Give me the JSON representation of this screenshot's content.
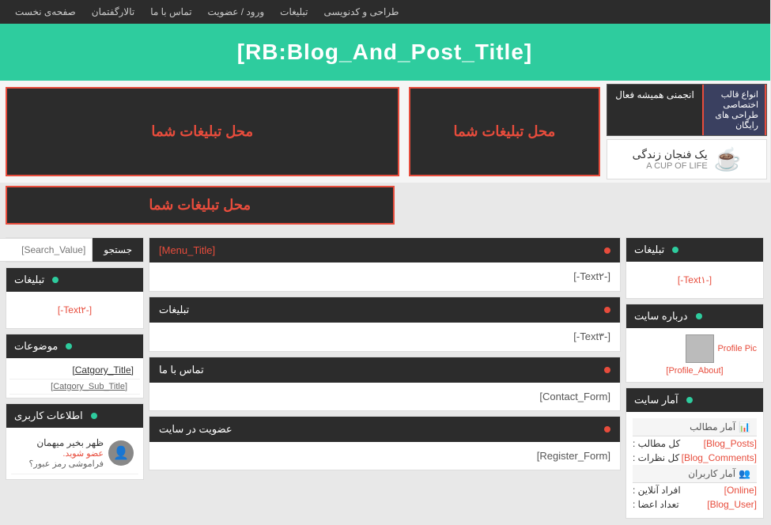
{
  "nav": {
    "items": [
      {
        "label": "صفحه‌ی نخست",
        "id": "home"
      },
      {
        "label": "تالارگفتمان",
        "id": "forum"
      },
      {
        "label": "تماس با ما",
        "id": "contact"
      },
      {
        "label": "ورود / عضویت",
        "id": "login"
      },
      {
        "label": "تبلیغات",
        "id": "ads"
      },
      {
        "label": "طراحی و کدنویسی",
        "id": "design"
      }
    ]
  },
  "header": {
    "title": "[RB:Blog_And_Post_Title]"
  },
  "ads": {
    "top_left_1": "محل تبلیغات شما",
    "top_right_1": "محل تبلیغات شما",
    "top_left_2": "محل تبلیغات شما",
    "cup_line1": "یک فنجان زندگی",
    "cup_line2": "A CUP OF LIFE",
    "forum_text": "انجمنی همیشه فعال",
    "forum_sub": "طراحی های رایگان",
    "forum_type": "انواع قالب اختصاصی"
  },
  "left_sidebar": {
    "ads_header": "تبلیغات",
    "ads_text": "[-Text۱-]",
    "about_header": "درباره سایت",
    "profile_pic_alt": "Profile Pic",
    "profile_about": "[Profile_About]",
    "stats_header": "آمار سایت",
    "stats_posts_label": "کل مطالب :",
    "stats_posts_value": "[Blog_Posts]",
    "stats_comments_label": "کل نظرات :",
    "stats_comments_value": "[Blog_Comments]",
    "stats_users_header": "آمار کاربران",
    "stats_online_label": "افراد آنلاین :",
    "stats_online_value": "[Online]",
    "stats_members_label": "تعداد اعضا :",
    "stats_members_value": "[Blog_User]",
    "stats_posts_section": "آمار مطالب"
  },
  "center": {
    "section1_title": "[Menu_Title]",
    "section1_text": "[-Text۲-]",
    "section2_title": "تبلیغات",
    "section2_text": "[-Text۳-]",
    "section3_title": "تماس با ما",
    "section3_form": "[Contact_Form]",
    "section4_title": "عضویت در سایت",
    "section4_form": "[Register_Form]"
  },
  "right_sidebar": {
    "search_btn": "جستجو",
    "search_placeholder": "[Search_Value]",
    "ads_header": "تبلیغات",
    "ads_text": "[-Text۲-]",
    "topics_header": "موضوعات",
    "cat_title": "[Catgory_Title]",
    "cat_sub": "[Catgory_Sub_Title]",
    "user_header": "اطلاعات کاربری",
    "user_greeting": "ظهر بخیر میهمان",
    "user_action": "عضو شوید.",
    "user_forgot": "فراموشی رمز عبور؟"
  },
  "icons": {
    "bullet_green": "●",
    "bullet_orange": "●",
    "stats_icon": "📊",
    "users_icon": "👥",
    "person_icon": "👤"
  }
}
